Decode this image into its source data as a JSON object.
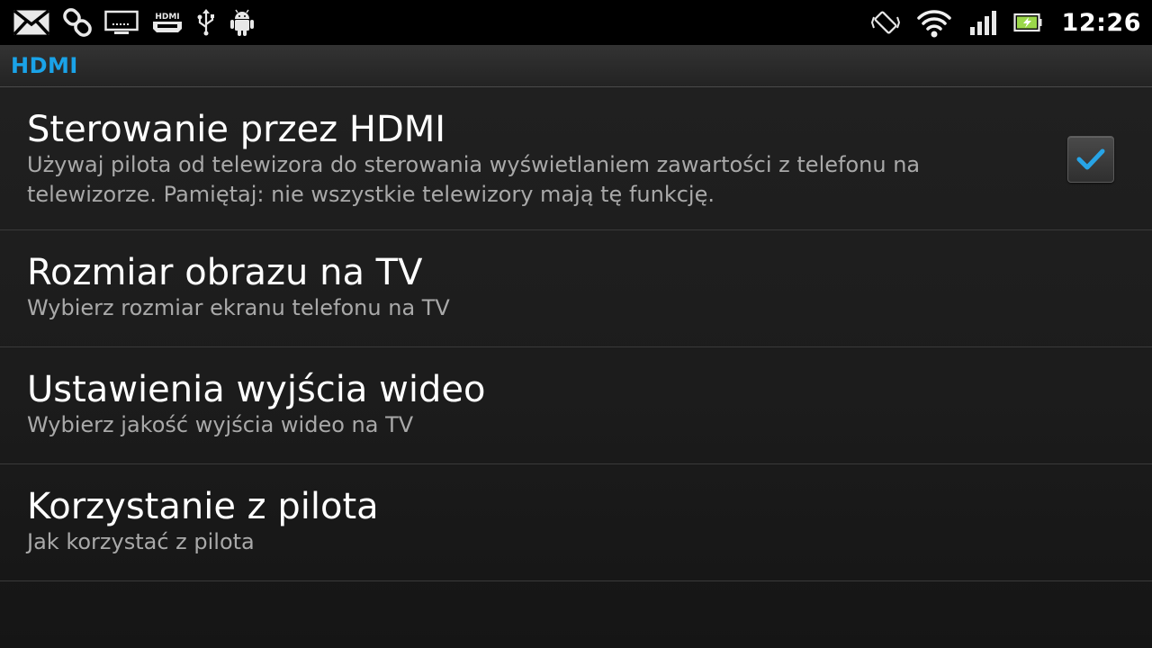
{
  "status_bar": {
    "clock": "12:26",
    "left_icons": [
      "mail-icon",
      "link-icon",
      "tv-out-icon",
      "hdmi-icon",
      "usb-icon",
      "android-debug-icon"
    ],
    "right_icons": [
      "rotate-icon",
      "wifi-icon",
      "signal-icon",
      "battery-icon"
    ],
    "hdmi_glyph_text": "HDMI"
  },
  "title_bar": {
    "title": "HDMI",
    "accent_color": "#1aa3e8"
  },
  "settings": {
    "items": [
      {
        "title": "Sterowanie przez HDMI",
        "summary": "Używaj pilota od telewizora do sterowania wyświetlaniem zawartości z telefonu na telewizorze. Pamiętaj: nie wszystkie telewizory mają tę funkcję.",
        "checked": true
      },
      {
        "title": "Rozmiar obrazu na TV",
        "summary": "Wybierz rozmiar ekranu telefonu na TV"
      },
      {
        "title": "Ustawienia wyjścia wideo",
        "summary": "Wybierz jakość wyjścia wideo na TV"
      },
      {
        "title": "Korzystanie z pilota",
        "summary": "Jak korzystać z pilota"
      }
    ]
  },
  "colors": {
    "checkmark": "#27a4e6",
    "battery_fill": "#9bd84a"
  }
}
